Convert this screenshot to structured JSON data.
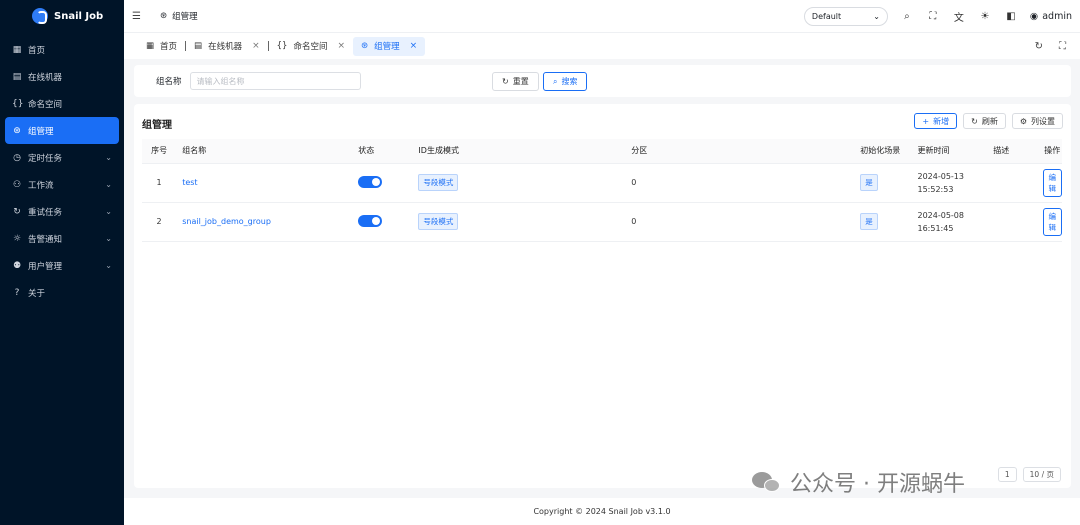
{
  "app": {
    "name": "Snail Job"
  },
  "sidebar": {
    "items": [
      {
        "label": "首页",
        "icon": "dashboard-icon",
        "glyph": "▦",
        "expandable": false
      },
      {
        "label": "在线机器",
        "icon": "server-icon",
        "glyph": "▤",
        "expandable": false
      },
      {
        "label": "命名空间",
        "icon": "namespace-icon",
        "glyph": "{}",
        "expandable": false
      },
      {
        "label": "组管理",
        "icon": "group-icon",
        "glyph": "⊛",
        "expandable": false,
        "active": true
      },
      {
        "label": "定时任务",
        "icon": "timer-icon",
        "glyph": "◷",
        "expandable": true
      },
      {
        "label": "工作流",
        "icon": "workflow-icon",
        "glyph": "⚇",
        "expandable": true
      },
      {
        "label": "重试任务",
        "icon": "retry-icon",
        "glyph": "↻",
        "expandable": true
      },
      {
        "label": "告警通知",
        "icon": "alarm-icon",
        "glyph": "☼",
        "expandable": true
      },
      {
        "label": "用户管理",
        "icon": "users-icon",
        "glyph": "⚉",
        "expandable": true
      },
      {
        "label": "关于",
        "icon": "help-icon",
        "glyph": "?",
        "expandable": false
      }
    ]
  },
  "header": {
    "breadcrumb": "组管理",
    "theme_select": "Default",
    "username": "admin"
  },
  "tabs": [
    {
      "label": "首页",
      "closable": false,
      "active": false
    },
    {
      "label": "在线机器",
      "closable": true,
      "active": false
    },
    {
      "label": "命名空间",
      "closable": true,
      "active": false
    },
    {
      "label": "组管理",
      "closable": true,
      "active": true
    }
  ],
  "search": {
    "label": "组名称",
    "placeholder": "请输入组名称",
    "value": "",
    "reset_label": "重置",
    "search_label": "搜索"
  },
  "card": {
    "title": "组管理",
    "add_label": "新增",
    "refresh_label": "刷新",
    "columns_label": "列设置"
  },
  "table": {
    "headers": [
      "序号",
      "组名称",
      "状态",
      "ID生成模式",
      "分区",
      "初始化场景",
      "更新时间",
      "描述",
      "操作"
    ],
    "rows": [
      {
        "index": "1",
        "name": "test",
        "enabled": true,
        "id_mode": "号段模式",
        "partition": "0",
        "init_scene": "是",
        "updated_date": "2024-05-13",
        "updated_time": "15:52:53",
        "description": "",
        "action": "编辑"
      },
      {
        "index": "2",
        "name": "snail_job_demo_group",
        "enabled": true,
        "id_mode": "号段模式",
        "partition": "0",
        "init_scene": "是",
        "updated_date": "2024-05-08",
        "updated_time": "16:51:45",
        "description": "",
        "action": "编辑"
      }
    ]
  },
  "pagination": {
    "current_page": "1",
    "page_size_label": "10 / 页"
  },
  "footer": {
    "copyright": "Copyright © 2024 Snail Job v3.1.0"
  },
  "watermark": {
    "text": "公众号 · 开源蜗牛"
  },
  "colors": {
    "primary": "#1a6ef5",
    "sidebar_bg": "#001428"
  }
}
